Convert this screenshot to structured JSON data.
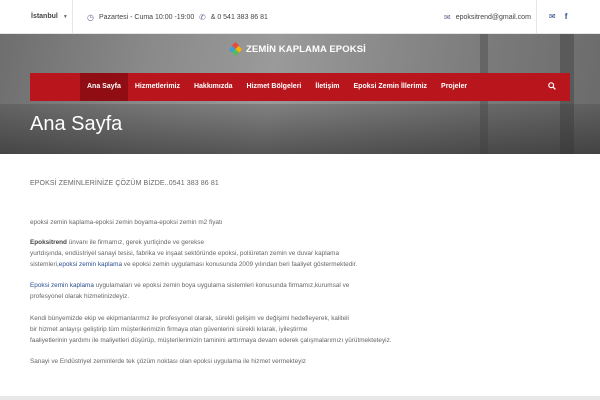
{
  "topbar": {
    "city": "İstanbul",
    "hours": "Pazartesi - Cuma 10:00 -19:00",
    "phone": "& 0 541 383 86 81",
    "email": "epoksitrend@gmail.com",
    "icons": [
      "clock-icon",
      "phone-icon",
      "mail-icon",
      "envelope-icon",
      "facebook-icon"
    ]
  },
  "logo": {
    "name": "ZEMİN KAPLAMA EPOKSİ"
  },
  "nav": {
    "items": [
      "Ana Sayfa",
      "Hizmetlerimiz",
      "Hakkımızda",
      "Hizmet Bölgeleri",
      "İletişim",
      "Epoksi Zemin İllerimiz",
      "Projeler"
    ],
    "active": "Ana Sayfa",
    "accent": "#b8151d"
  },
  "hero": {
    "title": "Ana Sayfa"
  },
  "content": {
    "lead": "EPOKSİ ZEMİNLERİNİZE ÇÖZÜM BİZDE..0541 383 86 81",
    "tags": "epoksi zemin kaplama-epoksi zemin boyama-epoksi zemin m2 fiyatı",
    "p1_bold": "Epoksitrend",
    "p1_l1": " ünvanı ile firmamız, gerek yurtiçinde ve gerekse",
    "p1_l2": "yurtdışında, endüstriyel sanayi tesisi, fabrika ve inşaat sektöründe epoksi, poliüretan zemin ve duvar kaplama",
    "p1_l3a": "sistemleri,",
    "p1_link": "epoksi zemin kaplama",
    "p1_l3b": " ve epoksi zemin uygulaması konusunda 2009 yılından beri faaliyet göstermektedir.",
    "p2_link": "Epoksi zemin kaplama",
    "p2_l1": " uygulamaları ve epoksi zemin boya uygulama sistemleri konusunda firmamız,kurumsal ve",
    "p2_l2": "profesyonel olarak hizmetinizdeyiz.",
    "p3_l1": "Kendi bünyemizde ekip ve ekipmanlarımız ile profesyonel olarak, sürekli gelişim ve değişimi hedefleyerek, kaliteli",
    "p3_l2": "bir hizmet anlayışı geliştirip tüm müşterilerimizin firmaya olan güvenlerini sürekli kılarak, iyileştirme",
    "p3_l3": "faaliyetlerinin yardımı ile maliyetleri düşürüp, müşterilerimizin taminini arttırmaya devam ederek çalışmalarımızı yürütmekteteyiz.",
    "p4": "Sanayi ve Endüstriyel zeminlerde tek çözüm noktası olan epoksi uygulama ile hizmet vermekteyiz"
  }
}
